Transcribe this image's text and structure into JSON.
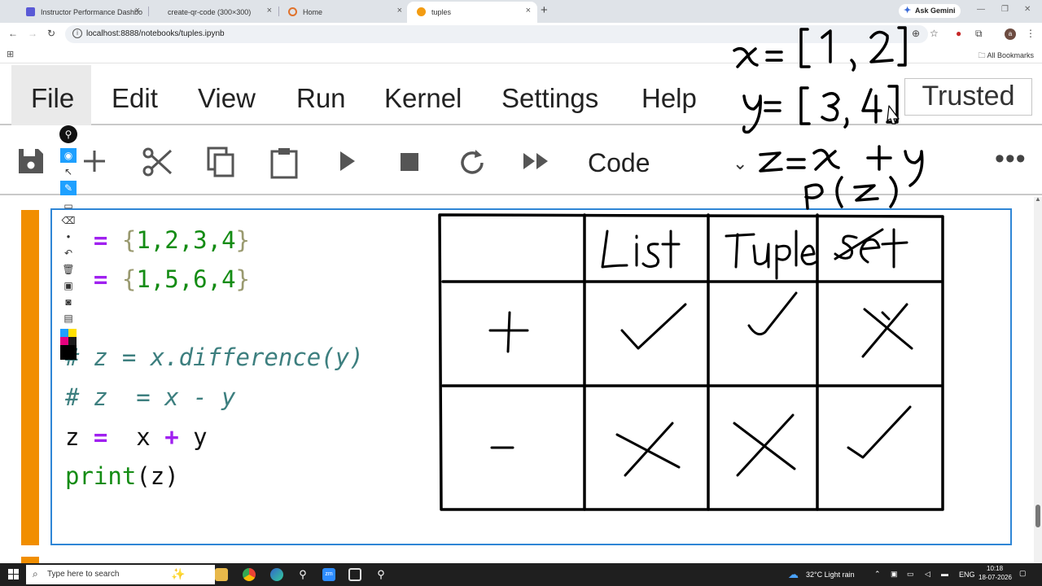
{
  "browser": {
    "tabs": [
      {
        "title": "Instructor Performance Dashbo",
        "active": false,
        "favicon_color": "#5a5ad6"
      },
      {
        "title": "create-qr-code (300×300)",
        "active": false,
        "favicon_color": "#bbbbbb"
      },
      {
        "title": "Home",
        "active": false,
        "favicon_color": "#e0722b"
      },
      {
        "title": "tuples",
        "active": true,
        "favicon_color": "#f39c12"
      }
    ],
    "new_tab": "+",
    "ask_gemini": "Ask Gemini",
    "url": "localhost:8888/notebooks/tuples.ipynb",
    "all_bookmarks": "All Bookmarks",
    "profile_initial": "a"
  },
  "jupyter": {
    "menu": [
      "File",
      "Edit",
      "View",
      "Run",
      "Kernel",
      "Settings",
      "Help"
    ],
    "trusted": "Trusted",
    "cell_type": "Code"
  },
  "code": {
    "line1": {
      "name": "",
      "op": "=",
      "open": "{",
      "nums": "1,2,3,4",
      "close": "}"
    },
    "line2": {
      "name": "",
      "op": "=",
      "open": "{",
      "nums": "1,5,6,4",
      "close": "}"
    },
    "line3": "# z = x.difference(y)",
    "line4": "# z  = x - y",
    "line5": {
      "a": "z ",
      "op": "=",
      "b": "  x ",
      "plus": "+",
      "c": " y"
    },
    "line6": {
      "fn": "print",
      "args": "(z)"
    }
  },
  "handwriting": {
    "top_right": [
      "x = [1, 2]",
      "y = [3, 4]",
      "z = x + y",
      "p(z)"
    ],
    "table": {
      "headers": [
        "",
        "List",
        "Tuple",
        "set"
      ],
      "rows": [
        {
          "op": "+",
          "list": "✓",
          "tuple": "✓",
          "set": "✗"
        },
        {
          "op": "-",
          "list": "✗",
          "tuple": "✗",
          "set": "✓"
        }
      ]
    }
  },
  "taskbar": {
    "search_placeholder": "Type here to search",
    "weather": "32°C  Light rain",
    "lang": "ENG",
    "time": "10:18",
    "date": "18-07-2026"
  },
  "colors": {
    "cell_marker": "#f18e00",
    "cell_border": "#2f86d6",
    "keyword": "#a020f0",
    "number": "#148c14",
    "comment": "#3d7f7f"
  }
}
